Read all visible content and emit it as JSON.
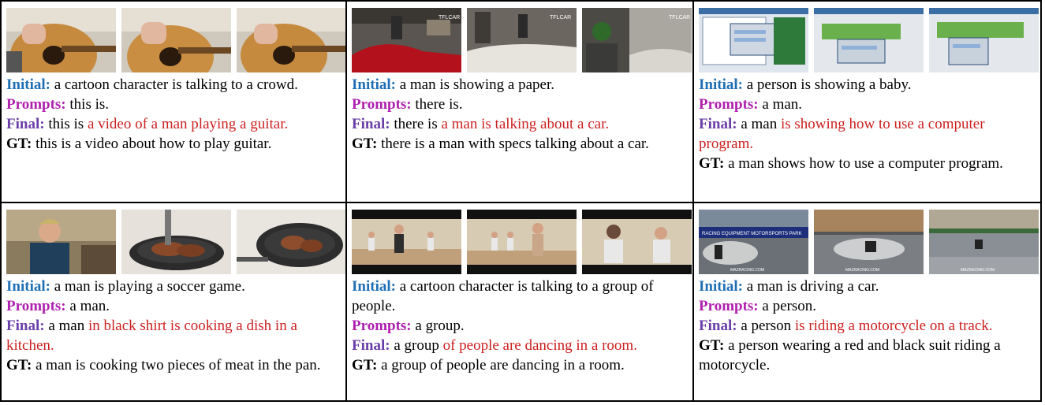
{
  "labels": {
    "initial": "Initial:",
    "prompts": "Prompts:",
    "final": "Final:",
    "gt": "GT:"
  },
  "colors": {
    "initial": "#1f6fb5",
    "prompts": "#b020b0",
    "final": "#6a3ea8",
    "generated": "#cc1f1f"
  },
  "examples": [
    {
      "initial": "a cartoon character is talking to a crowd.",
      "prompts": "this is.",
      "final_prefix": "this is",
      "final_generated": "a video of a man playing  a guitar.",
      "gt": "this is a video about how to play guitar."
    },
    {
      "initial": "a man is showing a paper.",
      "prompts": "there is.",
      "final_prefix": "there is",
      "final_generated": "a man is talking about a car.",
      "gt": "there is a man with specs talking about a car."
    },
    {
      "initial": "a person is showing a baby.",
      "prompts": "a man.",
      "final_prefix": "a man",
      "final_generated": "is showing how to use a computer program.",
      "gt": "a man shows how to use a computer program."
    },
    {
      "initial": "a man is playing a soccer game.",
      "prompts": "a man.",
      "final_prefix": "a man",
      "final_generated": "in black shirt is cooking a dish in a kitchen.",
      "gt": "a man is cooking two pieces of meat in the pan."
    },
    {
      "initial": "a cartoon character is talking to a group of people.",
      "prompts": "a group.",
      "final_prefix": "a group",
      "final_generated": "of people are dancing in a room.",
      "gt": "a group of people are dancing in a room."
    },
    {
      "initial": "a man is driving a car.",
      "prompts": "a person.",
      "final_prefix": "a person",
      "final_generated": "is riding a motorcycle on a track.",
      "gt": "a person wearing a red and black suit riding a motorcycle."
    }
  ],
  "frame_text": {
    "garage_logo": "TFLCAR",
    "race_banner": "RACING EQUIPMENT MOTORSPORTS PARK",
    "race_watermark": "MAZRACING.COM"
  }
}
